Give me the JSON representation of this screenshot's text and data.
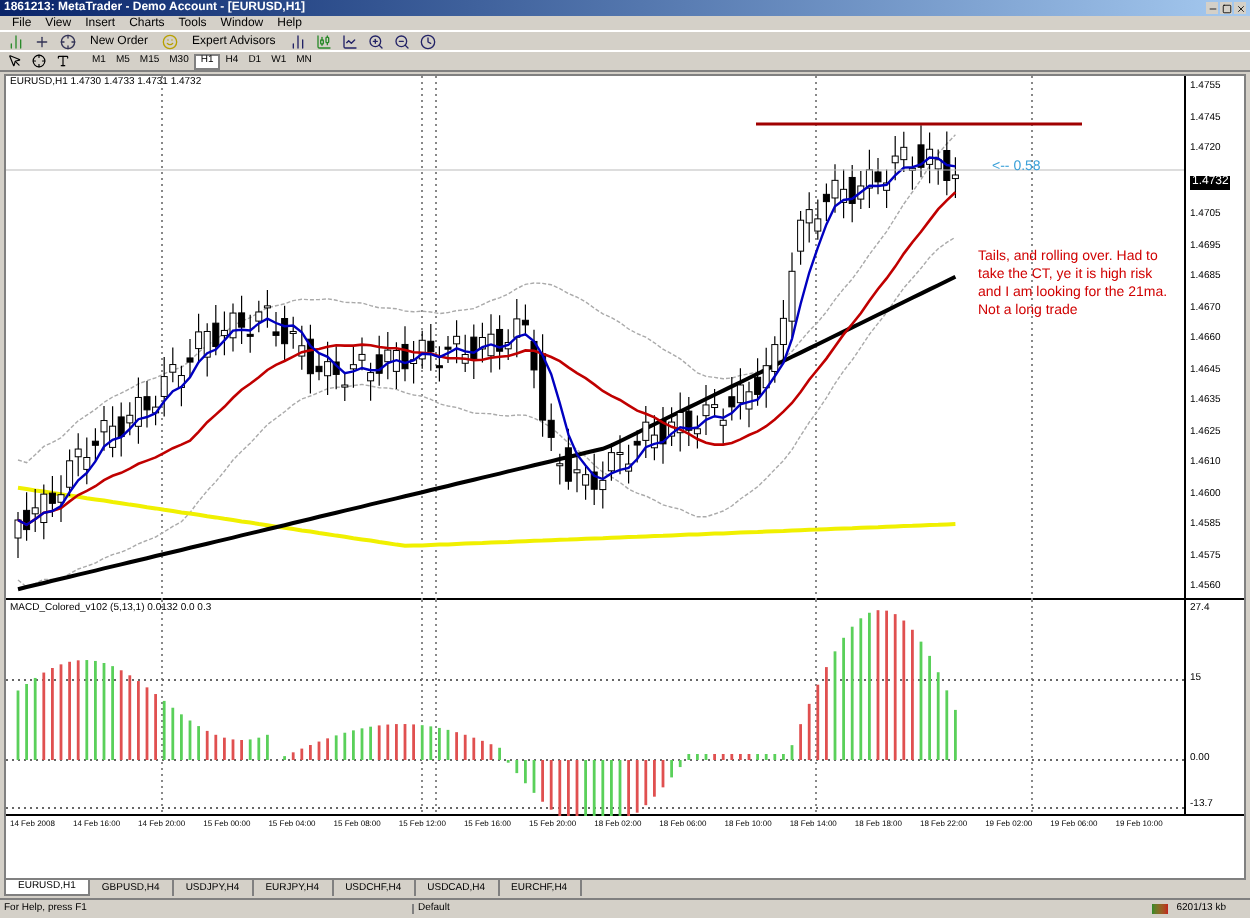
{
  "window": {
    "title": "1861213: MetaTrader - Demo Account - [EURUSD,H1]"
  },
  "menu": [
    "File",
    "View",
    "Insert",
    "Charts",
    "Tools",
    "Window",
    "Help"
  ],
  "toolbar": {
    "buttons": [
      "New Order",
      "Expert Advisors"
    ],
    "timeframes": [
      {
        "label": "M1",
        "selected": false
      },
      {
        "label": "M5",
        "selected": false
      },
      {
        "label": "M15",
        "selected": false
      },
      {
        "label": "M30",
        "selected": false
      },
      {
        "label": "H1",
        "selected": true
      },
      {
        "label": "H4",
        "selected": false
      },
      {
        "label": "D1",
        "selected": false
      },
      {
        "label": "W1",
        "selected": false
      },
      {
        "label": "MN",
        "selected": false
      }
    ]
  },
  "chart": {
    "header": "EURUSD,H1 1.4730 1.4733 1.4731 1.4732",
    "price_marker": "<-- 0.58",
    "note": "Tails, and rolling over. Had to take the CT, ye it is high risk and I am looking for the 21ma. Not a long trade",
    "current_price": "1.4732",
    "price_axis": [
      "1.4755",
      "1.4745",
      "1.4720",
      "1.4705",
      "1.4695",
      "1.4685",
      "1.4670",
      "1.4660",
      "1.4645",
      "1.4635",
      "1.4625",
      "1.4610",
      "1.4600",
      "1.4585",
      "1.4575",
      "1.4560"
    ]
  },
  "macd": {
    "label": "MACD_Colored_v102 (5,13,1) 0.0132 0.0 0.3",
    "axis": [
      "27.4",
      "15",
      "0.00",
      "-13.7"
    ]
  },
  "time_axis": [
    "14 Feb 2008",
    "14 Feb 16:00",
    "14 Feb 20:00",
    "15 Feb 00:00",
    "15 Feb 04:00",
    "15 Feb 08:00",
    "15 Feb 12:00",
    "15 Feb 16:00",
    "15 Feb 20:00",
    "18 Feb 02:00",
    "18 Feb 06:00",
    "18 Feb 10:00",
    "18 Feb 14:00",
    "18 Feb 18:00",
    "18 Feb 22:00",
    "19 Feb 02:00",
    "19 Feb 06:00",
    "19 Feb 10:00"
  ],
  "tabs": [
    {
      "label": "EURUSD,H1",
      "selected": true
    },
    {
      "label": "GBPUSD,H4",
      "selected": false
    },
    {
      "label": "USDJPY,H4",
      "selected": false
    },
    {
      "label": "EURJPY,H4",
      "selected": false
    },
    {
      "label": "USDCHF,H4",
      "selected": false
    },
    {
      "label": "USDCAD,H4",
      "selected": false
    },
    {
      "label": "EURCHF,H4",
      "selected": false
    }
  ],
  "status_bar": [
    "For Help, press F1",
    "Default",
    "6201/13 kb"
  ]
}
